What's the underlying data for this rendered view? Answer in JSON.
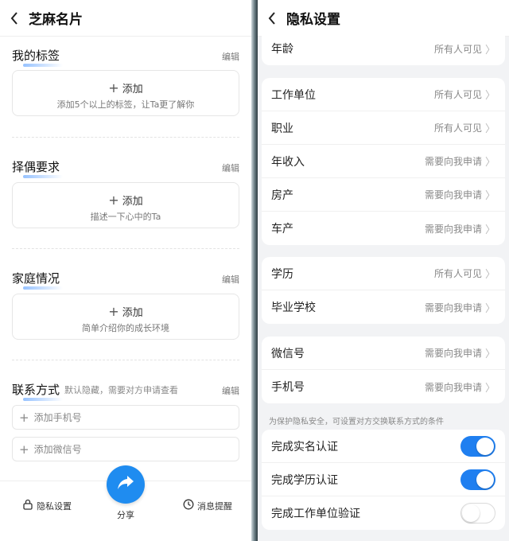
{
  "left": {
    "title": "芝麻名片",
    "edit_label": "编辑",
    "add_label": "添加",
    "tags": {
      "title": "我的标签",
      "hint": "添加5个以上的标签，让Ta更了解你"
    },
    "partner": {
      "title": "择偶要求",
      "hint": "描述一下心中的Ta"
    },
    "family": {
      "title": "家庭情况",
      "hint": "简单介绍你的成长环境"
    },
    "contact": {
      "title": "联系方式",
      "note": "默认隐藏，需要对方申请查看",
      "phone": "添加手机号",
      "wechat": "添加微信号"
    },
    "bottom": {
      "privacy": "隐私设置",
      "share": "分享",
      "notify": "消息提醒"
    }
  },
  "right": {
    "title": "隐私设置",
    "age": {
      "label": "年龄",
      "value": "所有人可见"
    },
    "group1": [
      {
        "label": "工作单位",
        "value": "所有人可见"
      },
      {
        "label": "职业",
        "value": "所有人可见"
      },
      {
        "label": "年收入",
        "value": "需要向我申请"
      },
      {
        "label": "房产",
        "value": "需要向我申请"
      },
      {
        "label": "车产",
        "value": "需要向我申请"
      }
    ],
    "group2": [
      {
        "label": "学历",
        "value": "所有人可见"
      },
      {
        "label": "毕业学校",
        "value": "需要向我申请"
      }
    ],
    "group3": [
      {
        "label": "微信号",
        "value": "需要向我申请"
      },
      {
        "label": "手机号",
        "value": "需要向我申请"
      }
    ],
    "hint": "为保护隐私安全，可设置对方交换联系方式的条件",
    "toggles": [
      {
        "label": "完成实名认证",
        "on": true
      },
      {
        "label": "完成学历认证",
        "on": true
      },
      {
        "label": "完成工作单位验证",
        "on": false
      }
    ]
  },
  "colors": {
    "accent": "#1f7ff0",
    "share": "#1f8cf0"
  }
}
